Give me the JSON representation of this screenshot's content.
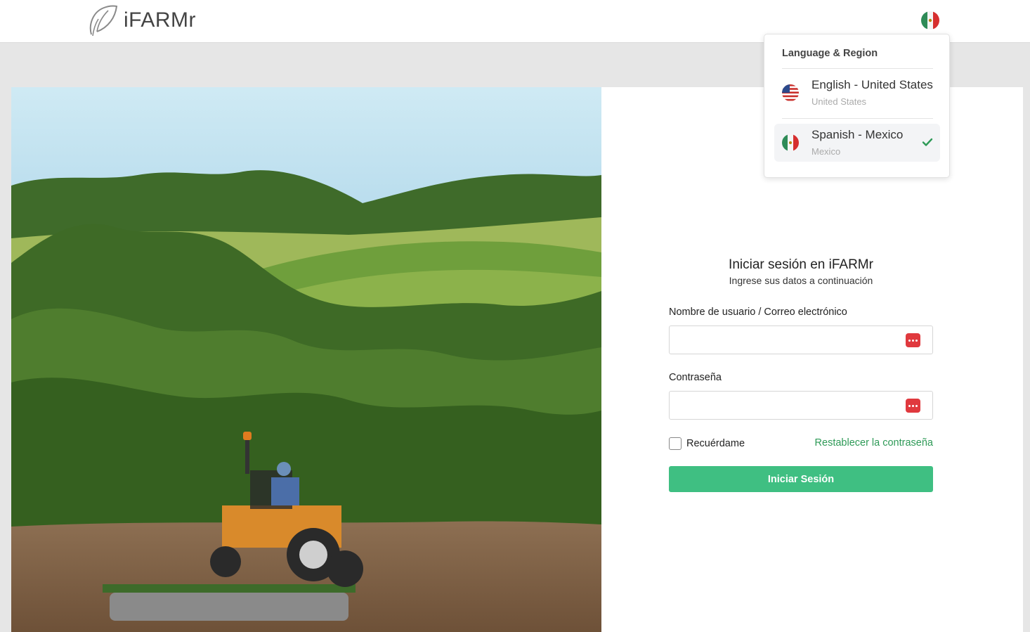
{
  "app": {
    "name": "iFARMr"
  },
  "header": {
    "current_locale_flag": "mexico-flag"
  },
  "language_menu": {
    "title": "Language & Region",
    "items": [
      {
        "name": "English - United States",
        "region": "United States",
        "flag": "us-flag",
        "selected": false
      },
      {
        "name": "Spanish - Mexico",
        "region": "Mexico",
        "flag": "mexico-flag",
        "selected": true
      }
    ]
  },
  "login": {
    "title": "Iniciar sesión en iFARMr",
    "subtitle": "Ingrese sus datos a continuación",
    "username_label": "Nombre de usuario / Correo electrónico",
    "username_value": "",
    "password_label": "Contraseña",
    "password_value": "",
    "remember_label": "Recuérdame",
    "remember_checked": false,
    "reset_link": "Restablecer la contraseña",
    "submit_label": "Iniciar Sesión"
  },
  "colors": {
    "primary": "#3fbf82",
    "link": "#2e9a57",
    "password_manager_icon": "#e0393e"
  }
}
